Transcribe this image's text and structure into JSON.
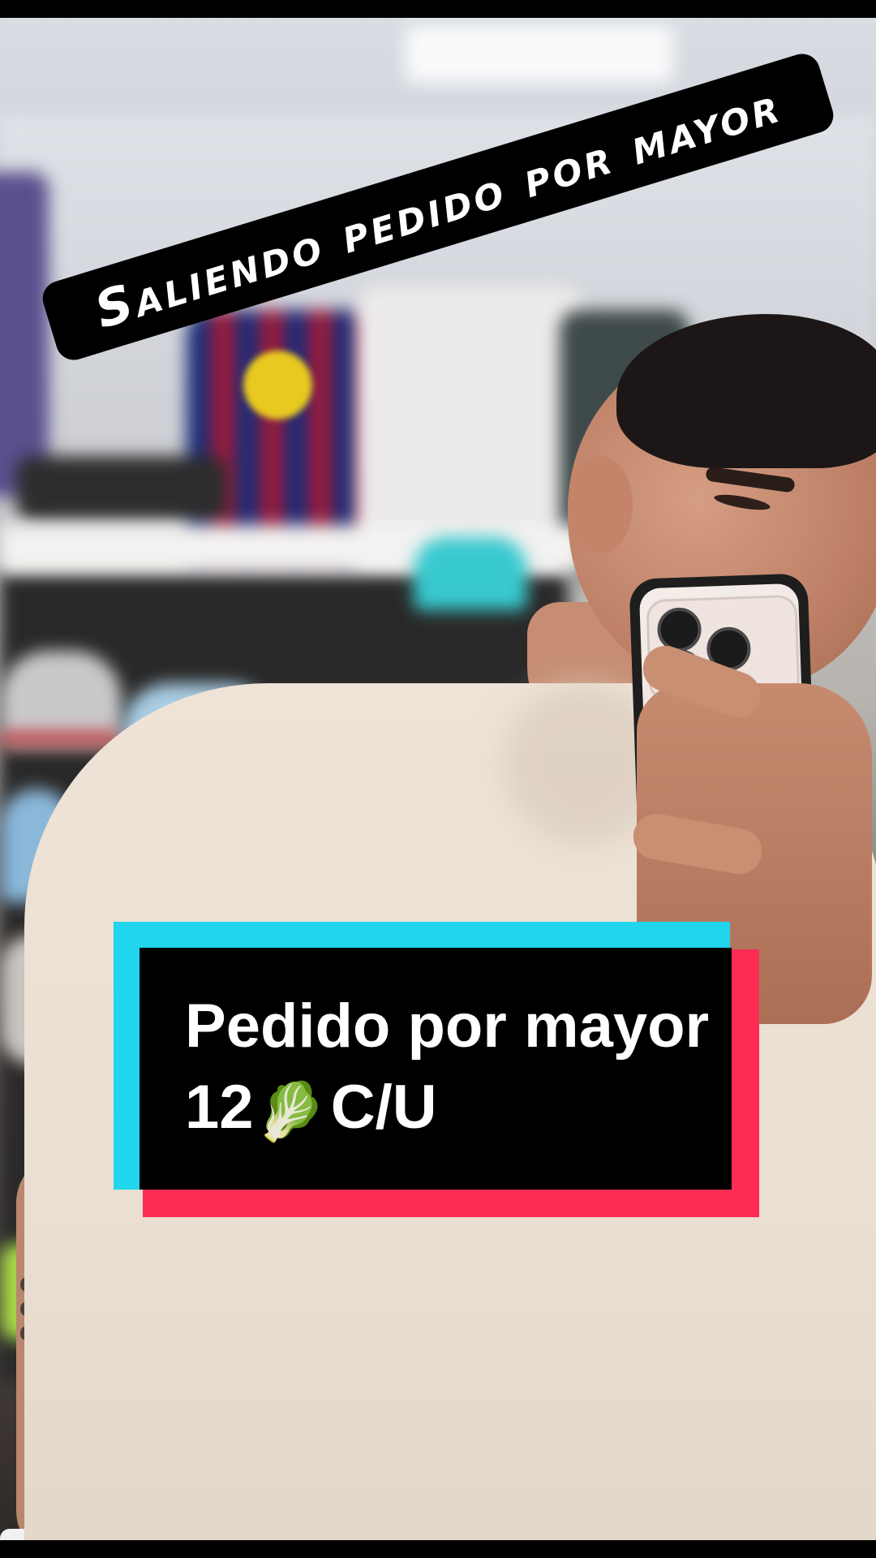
{
  "overlay": {
    "banner_text": "Saliendo pedido por mayor",
    "card_line1": "Pedido por mayor",
    "card_line2_prefix": "12",
    "card_emoji": "🥬",
    "card_line2_suffix": "C/U"
  },
  "colors": {
    "cyan": "#20d5ec",
    "red": "#fe2c55",
    "black": "#000000",
    "white": "#ffffff"
  }
}
